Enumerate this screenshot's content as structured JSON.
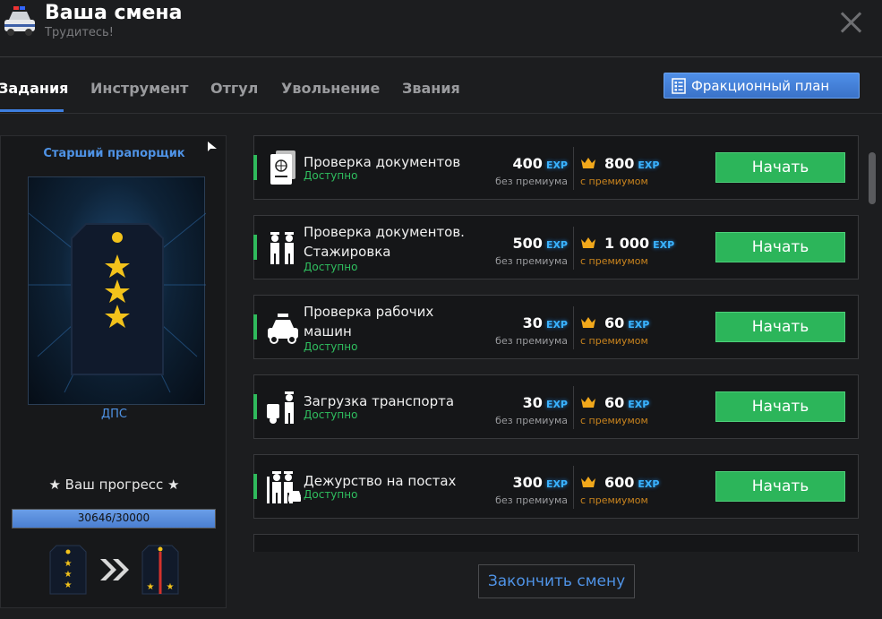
{
  "header": {
    "title": "Ваша смена",
    "subtitle": "Трудитесь!",
    "icon": "police-car-icon"
  },
  "tabs": [
    {
      "label": "Задания",
      "active": true
    },
    {
      "label": "Инструмент",
      "active": false
    },
    {
      "label": "Отгул",
      "active": false
    },
    {
      "label": "Увольнение",
      "active": false
    },
    {
      "label": "Звания",
      "active": false
    }
  ],
  "plan_button": {
    "label": "Фракционный план",
    "icon": "checklist-icon"
  },
  "rank": {
    "name": "Старший прапорщик",
    "department": "ДПС",
    "progress_title": "★ Ваш прогресс ★",
    "progress_text": "30646/30000",
    "progress_fraction": 1.0
  },
  "tasks": [
    {
      "name": "Проверка документов",
      "status": "Доступно",
      "base_exp": "400",
      "prem_exp": "800",
      "icon": "passport-icon"
    },
    {
      "name": "Проверка документов. Стажировка",
      "status": "Доступно",
      "base_exp": "500",
      "prem_exp": "1 000",
      "icon": "officers-icon"
    },
    {
      "name": "Проверка рабочих машин",
      "status": "Доступно",
      "base_exp": "30",
      "prem_exp": "60",
      "icon": "police-car-icon"
    },
    {
      "name": "Загрузка транспорта",
      "status": "Доступно",
      "base_exp": "30",
      "prem_exp": "60",
      "icon": "tow-truck-icon"
    },
    {
      "name": "Дежурство на постах",
      "status": "Доступно",
      "base_exp": "300",
      "prem_exp": "600",
      "icon": "patrol-post-icon"
    }
  ],
  "labels": {
    "exp": "EXP",
    "no_premium": "без премиума",
    "with_premium": "с премиумом",
    "start": "Начать"
  },
  "end_shift_button": "Закончить смену",
  "colors": {
    "accent_blue": "#3e7fe0",
    "start_green": "#2cb55a",
    "status_green": "#2fbf5f",
    "exp_blue": "#3ab3ff",
    "premium_gold": "#c9841e"
  }
}
